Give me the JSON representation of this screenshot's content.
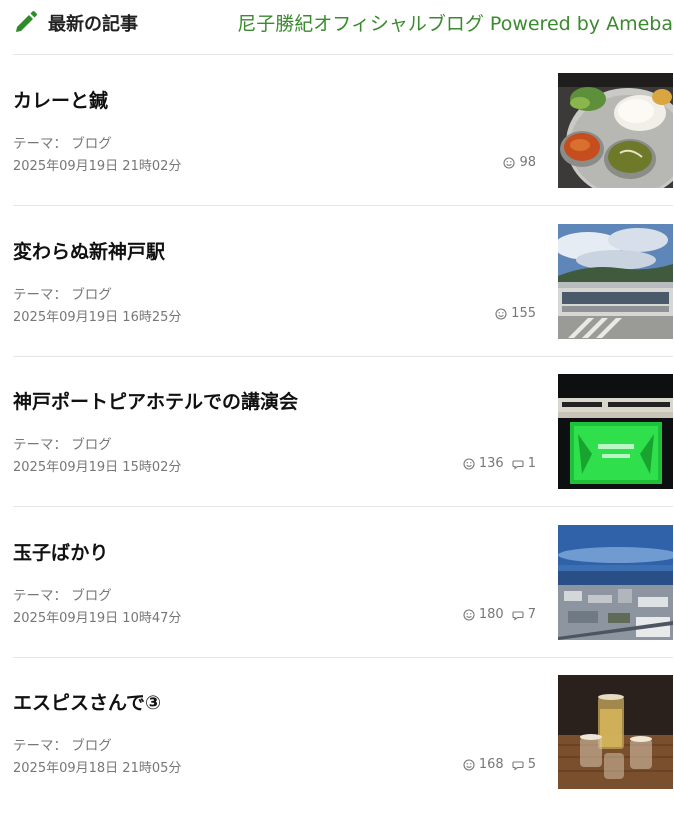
{
  "header": {
    "section_title": "最新の記事",
    "blog_name": "尼子勝紀オフィシャルブログ Powered by Ameba"
  },
  "entries": [
    {
      "title": "カレーと鍼",
      "theme_label": "テーマ：",
      "theme": "ブログ",
      "date": "2025年09月19日 21時02分",
      "likes": "98",
      "comments": "",
      "thumb_icon": "curry-plate-photo"
    },
    {
      "title": "変わらぬ新神戸駅",
      "theme_label": "テーマ：",
      "theme": "ブログ",
      "date": "2025年09月19日 16時25分",
      "likes": "155",
      "comments": "",
      "thumb_icon": "station-building-photo"
    },
    {
      "title": "神戸ポートピアホテルでの講演会",
      "theme_label": "テーマ：",
      "theme": "ブログ",
      "date": "2025年09月19日 15時02分",
      "likes": "136",
      "comments": "1",
      "thumb_icon": "lecture-screen-photo"
    },
    {
      "title": "玉子ばかり",
      "theme_label": "テーマ：",
      "theme": "ブログ",
      "date": "2025年09月19日 10時47分",
      "likes": "180",
      "comments": "7",
      "thumb_icon": "city-ocean-view-photo"
    },
    {
      "title": "エスピスさんで③",
      "theme_label": "テーマ：",
      "theme": "ブログ",
      "date": "2025年09月18日 21時05分",
      "likes": "168",
      "comments": "5",
      "thumb_icon": "glasses-on-table-photo"
    }
  ],
  "colors": {
    "accent_green": "#3a8a2e",
    "pencil_green": "#2f8a2a",
    "meta_gray": "#777777"
  }
}
